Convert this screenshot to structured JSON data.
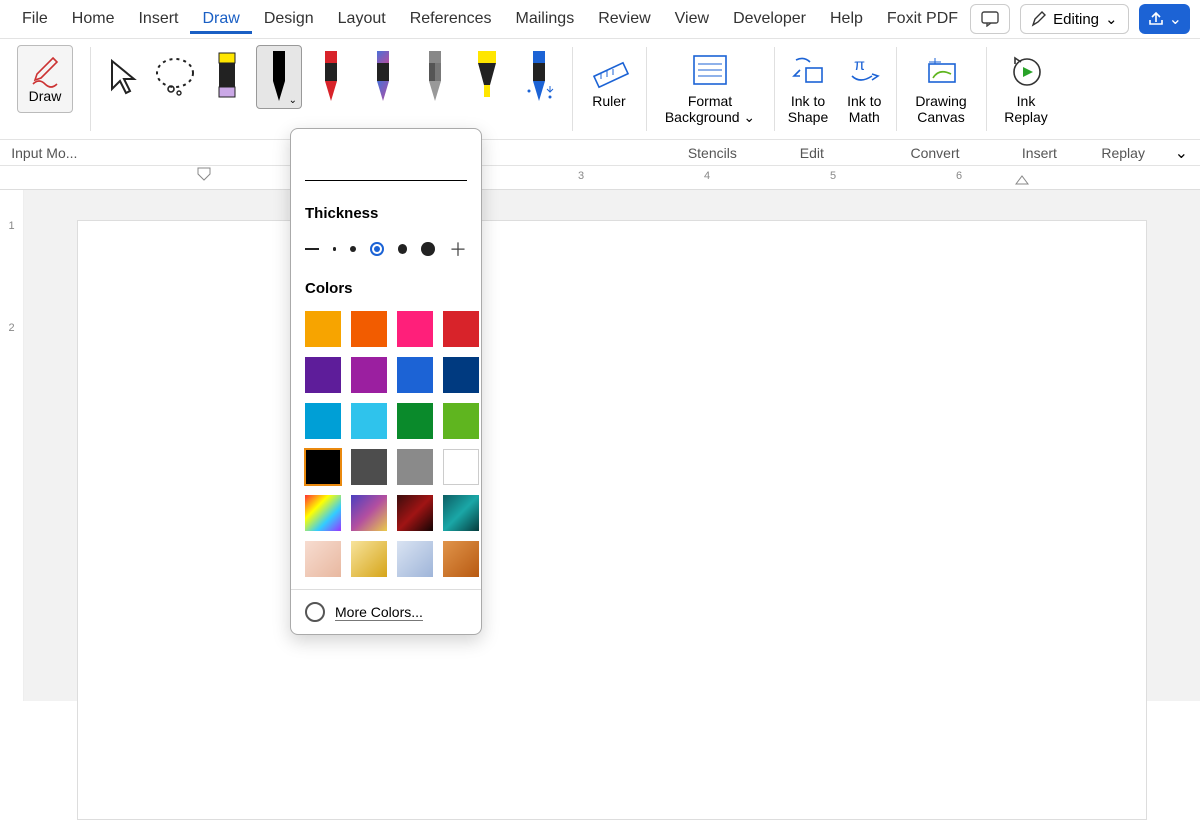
{
  "menu": {
    "items": [
      "File",
      "Home",
      "Insert",
      "Draw",
      "Design",
      "Layout",
      "References",
      "Mailings",
      "Review",
      "View",
      "Developer",
      "Help",
      "Foxit PDF"
    ],
    "active": "Draw",
    "comments_icon": "comment-icon",
    "editing_label": "Editing",
    "share_icon": "share-icon"
  },
  "ribbon": {
    "draw_label": "Draw",
    "tools": {
      "pointer": "pointer-tool",
      "lasso": "lasso-tool",
      "eraser": "eraser-tool",
      "pens": [
        {
          "name": "pen-black",
          "color": "#000000",
          "selected": true
        },
        {
          "name": "pen-red",
          "color": "#d8232a"
        },
        {
          "name": "pen-galaxy",
          "color": "linear-gradient(135deg,#4a6fd8,#b34fa0)"
        },
        {
          "name": "pencil-gray",
          "color": "#7a7a7a"
        },
        {
          "name": "highlighter-yellow",
          "color": "#ffe600"
        },
        {
          "name": "action-pen-blue",
          "color": "#1c63d5"
        }
      ]
    },
    "ruler_label": "Ruler",
    "format_bg_label": "Format Background",
    "ink_shape_label": "Ink to Shape",
    "ink_math_label": "Ink to Math",
    "drawing_canvas_label": "Drawing Canvas",
    "ink_replay_label": "Ink Replay"
  },
  "groups": {
    "input_mode": "Input Mo...",
    "stencils": "Stencils",
    "edit": "Edit",
    "convert": "Convert",
    "insert": "Insert",
    "replay": "Replay"
  },
  "popover": {
    "thickness_label": "Thickness",
    "colors_label": "Colors",
    "more_colors_label": "More Colors...",
    "thickness_selected_index": 2,
    "colors": [
      {
        "hex": "#f7a400"
      },
      {
        "hex": "#f25c00"
      },
      {
        "hex": "#ff1f7a"
      },
      {
        "hex": "#d8232a"
      },
      {
        "hex": "#5e1d9a"
      },
      {
        "hex": "#9b1fa0"
      },
      {
        "hex": "#1c63d5"
      },
      {
        "hex": "#003a80"
      },
      {
        "hex": "#009fd6"
      },
      {
        "hex": "#2fc3ec"
      },
      {
        "hex": "#0a8a2b"
      },
      {
        "hex": "#5fb51f"
      },
      {
        "hex": "#000000",
        "selected": true
      },
      {
        "hex": "#4d4d4d"
      },
      {
        "hex": "#8a8a8a"
      },
      {
        "hex": "#ffffff",
        "border": true
      },
      {
        "hex": "linear-gradient(135deg,#f33,#ff0,#3cf,#93f)"
      },
      {
        "hex": "linear-gradient(135deg,#4a3fbf,#b34fa0,#eacb4a)"
      },
      {
        "hex": "linear-gradient(135deg,#3b0d0d,#a01414,#120404)"
      },
      {
        "hex": "linear-gradient(135deg,#0d5e63,#1aa7a7,#053b3c)"
      },
      {
        "hex": "linear-gradient(135deg,#f7dcd0,#e8b8a0)"
      },
      {
        "hex": "linear-gradient(135deg,#f7e39b,#d6a51a)"
      },
      {
        "hex": "linear-gradient(135deg,#d9e3f2,#9fb5d9)"
      },
      {
        "hex": "linear-gradient(135deg,#e0944a,#b85a12)"
      }
    ]
  },
  "ruler": {
    "marks": [
      "3",
      "4",
      "5",
      "6"
    ]
  },
  "left_ruler": {
    "marks": [
      "1",
      "2"
    ]
  }
}
